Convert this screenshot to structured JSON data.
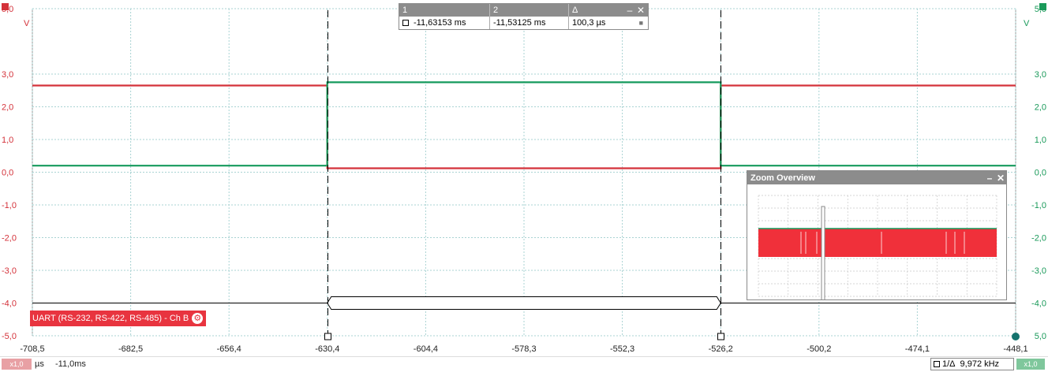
{
  "chart_data": {
    "type": "line",
    "title": "",
    "x_ticks": [
      "-708,5",
      "-682,5",
      "-656,4",
      "-630,4",
      "-604,4",
      "-578,3",
      "-552,3",
      "-526,2",
      "-500,2",
      "-474,1",
      "-448,1"
    ],
    "xlim": [
      -708.5,
      -448.1
    ],
    "ylim": [
      -5.0,
      5.0
    ],
    "left_axis": {
      "unit": "V",
      "top_label": "5,0",
      "ticks": [
        "5,0",
        "3,0",
        "2,0",
        "1,0",
        "0,0",
        "-1,0",
        "-2,0",
        "-3,0",
        "-4,0",
        "-5,0"
      ],
      "color": "#d4323a"
    },
    "right_axis": {
      "unit": "V",
      "top_label": "5,0",
      "ticks": [
        "5,0",
        "3,0",
        "2,0",
        "1,0",
        "0,0",
        "-1,0",
        "-2,0",
        "-3,0",
        "-4,0",
        "5,0"
      ],
      "color": "#1a9a5a"
    },
    "series": [
      {
        "color": "#d4323a",
        "x": [
          -708.5,
          -630.4,
          -630.4,
          -526.2,
          -526.2,
          -448.1
        ],
        "y": [
          2.65,
          2.65,
          0.12,
          0.12,
          2.65,
          2.65
        ]
      },
      {
        "color": "#149a5c",
        "x": [
          -708.5,
          -630.4,
          -630.4,
          -526.2,
          -526.2,
          -448.1
        ],
        "y": [
          0.2,
          0.2,
          2.75,
          2.75,
          0.2,
          0.2
        ]
      }
    ],
    "cursors": [
      -630.4,
      -526.2
    ],
    "grid": true
  },
  "measurements": {
    "headers": [
      "1",
      "2",
      "Δ"
    ],
    "values": [
      "-11,63153 ms",
      "-11,53125 ms",
      "100,3 µs"
    ],
    "minimize": "–",
    "close": "✕"
  },
  "zoom_overview": {
    "title": "Zoom Overview",
    "minimize": "–",
    "close": "✕",
    "trace_color": "#f0303a"
  },
  "decoder": {
    "label": "UART (RS-232, RS-422, RS-485) - Ch B"
  },
  "statusbar": {
    "left_badge": "x1,0",
    "unit": "µs",
    "offset": "-11,0ms",
    "freq_label": "1/Δ",
    "freq_value": "9,972 kHz",
    "right_badge": "x1,0"
  }
}
